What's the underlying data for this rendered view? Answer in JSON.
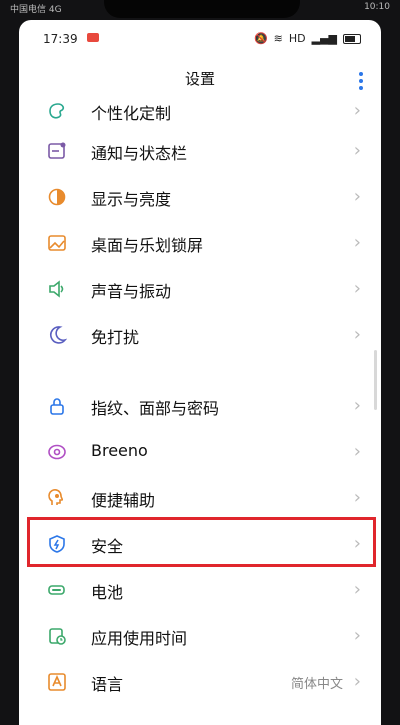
{
  "outer_status": {
    "left": "中国电信 4G",
    "right": "10:10"
  },
  "status": {
    "time": "17:39",
    "network": "HD",
    "battery_icon": "battery-icon"
  },
  "header": {
    "title": "设置"
  },
  "items": [
    {
      "label": "个性化定制",
      "icon": "palette-icon",
      "color": "#2aa88f"
    },
    {
      "label": "通知与状态栏",
      "icon": "notification-icon",
      "color": "#7b5aa6"
    },
    {
      "label": "显示与亮度",
      "icon": "brightness-icon",
      "color": "#e88b2d"
    },
    {
      "label": "桌面与乐划锁屏",
      "icon": "wallpaper-icon",
      "color": "#e88b2d"
    },
    {
      "label": "声音与振动",
      "icon": "volume-icon",
      "color": "#3ca86b"
    },
    {
      "label": "免打扰",
      "icon": "moon-icon",
      "color": "#5a5fc0"
    },
    {
      "label": "指纹、面部与密码",
      "icon": "lock-icon",
      "color": "#2c77e8"
    },
    {
      "label": "Breeno",
      "icon": "breeno-icon",
      "color": "#b04fc4"
    },
    {
      "label": "便捷辅助",
      "icon": "assist-icon",
      "color": "#e88b2d"
    },
    {
      "label": "安全",
      "icon": "shield-icon",
      "color": "#2c77e8"
    },
    {
      "label": "电池",
      "icon": "battery-icon",
      "color": "#3ca86b"
    },
    {
      "label": "应用使用时间",
      "icon": "timer-icon",
      "color": "#3ca86b"
    },
    {
      "label": "语言",
      "icon": "language-icon",
      "color": "#e88b2d",
      "value": "简体中文"
    }
  ],
  "chevron": "›"
}
